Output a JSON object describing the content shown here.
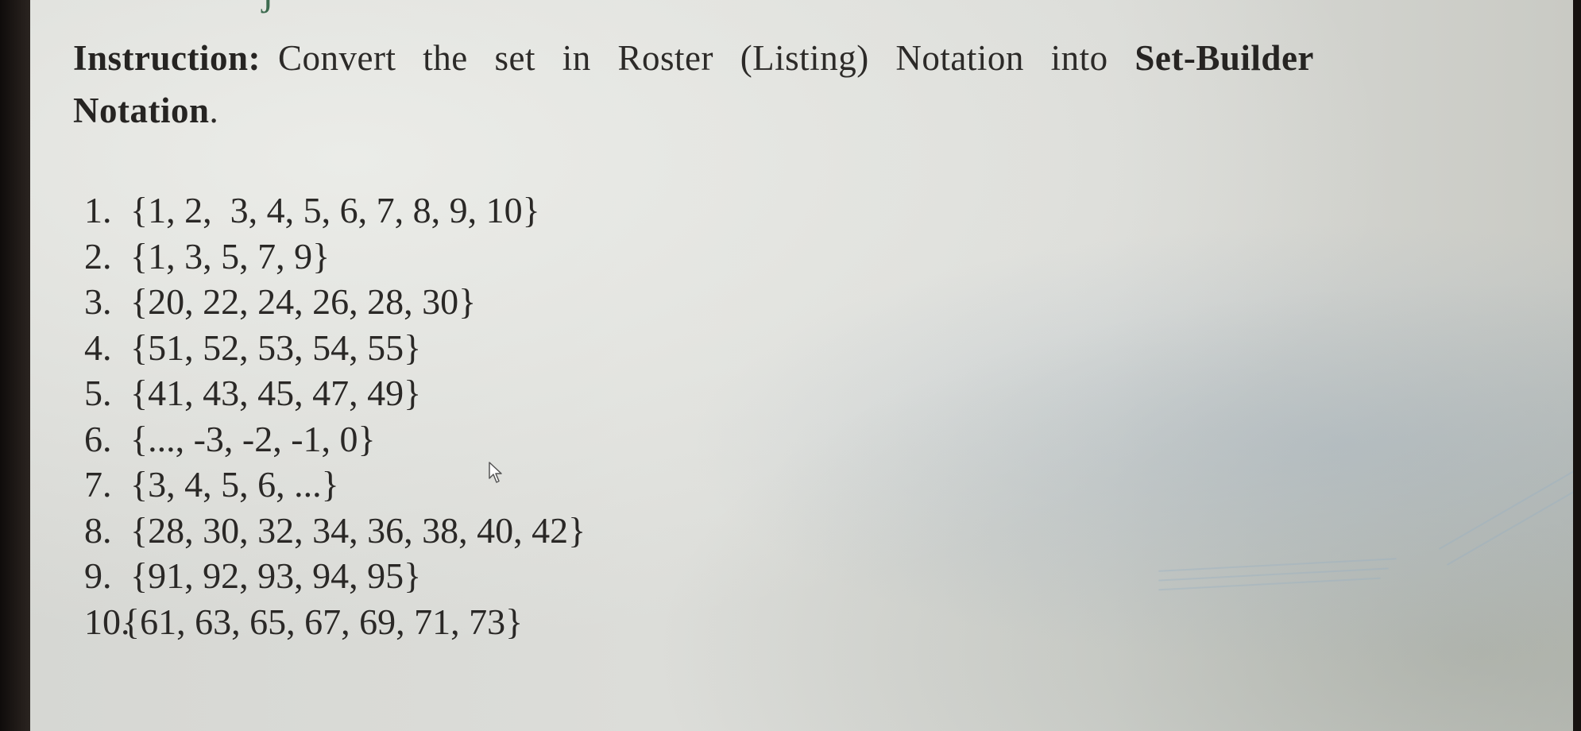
{
  "document": {
    "instruction": {
      "label": "Instruction:",
      "text_before_bold": "Convert the set in Roster (Listing) Notation into",
      "bold_term": "Set-Builder",
      "bold_continuation": "Notation",
      "ending": "."
    },
    "problems": [
      {
        "number": "1.",
        "set": "{1, 2,  3, 4, 5, 6, 7, 8, 9, 10}"
      },
      {
        "number": "2.",
        "set": "{1, 3, 5, 7, 9}"
      },
      {
        "number": "3.",
        "set": "{20, 22, 24, 26, 28, 30}"
      },
      {
        "number": "4.",
        "set": "{51, 52, 53, 54, 55}"
      },
      {
        "number": "5.",
        "set": "{41, 43, 45, 47, 49}"
      },
      {
        "number": "6.",
        "set": "{..., -3, -2, -1, 0}"
      },
      {
        "number": "7.",
        "set": "{3, 4, 5, 6, ...}"
      },
      {
        "number": "8.",
        "set": "{28, 30, 32, 34, 36, 38, 40, 42}"
      },
      {
        "number": "9.",
        "set": "{91, 92, 93, 94, 95}"
      },
      {
        "number": "10.",
        "set": "{61, 63, 65, 67, 69, 71, 73}"
      }
    ]
  },
  "cursor": {
    "icon": "mouse-pointer-arrow-icon"
  },
  "colors": {
    "text": "#2a2826",
    "screen_background": "#d9dad6",
    "bezel": "#1a1614"
  }
}
